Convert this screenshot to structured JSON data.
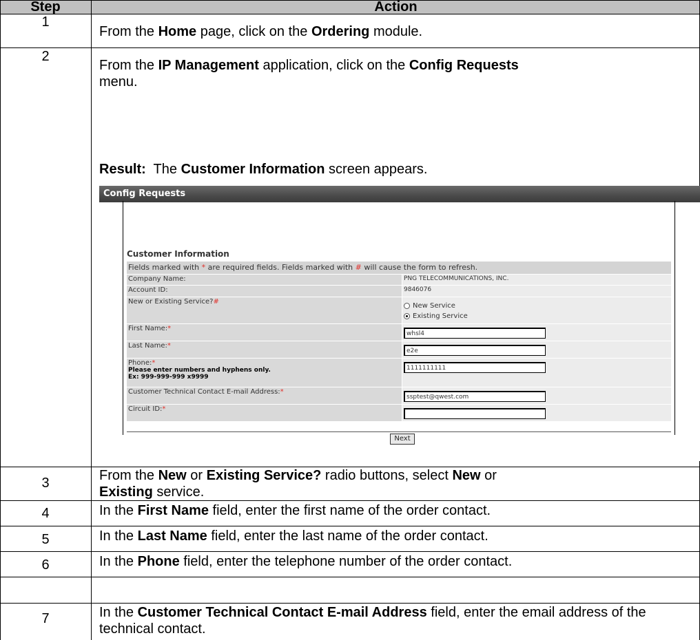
{
  "headers": {
    "step": "Step",
    "action": "Action"
  },
  "rows": [
    {
      "num": "1",
      "parts": [
        "From the ",
        "Home",
        " page, click on the ",
        "Ordering",
        " module."
      ]
    },
    {
      "num": "2",
      "parts": [
        "From the ",
        "IP Management",
        " application, click on the ",
        "Config Requests",
        " menu."
      ],
      "result_label": "Result:",
      "result_parts": [
        "  The ",
        "Customer Information",
        " screen appears."
      ]
    },
    {
      "num": "3",
      "parts": [
        "From the ",
        "New",
        " or ",
        "Existing Service?",
        " radio buttons, select ",
        "New",
        " or ",
        "Existing",
        " service."
      ]
    },
    {
      "num": "4",
      "parts": [
        "In the ",
        "First Name",
        " field, enter the first name of the order contact."
      ]
    },
    {
      "num": "5",
      "parts": [
        "In the ",
        "Last Name",
        " field, enter the last name of the order contact."
      ]
    },
    {
      "num": "6",
      "parts": [
        "In the ",
        "Phone",
        " field, enter the telephone number of the order contact."
      ]
    },
    {
      "num": "7",
      "parts": [
        "In the ",
        "Customer Technical Contact E-mail Address",
        " field, enter the email address of the technical contact."
      ]
    }
  ],
  "screenshot": {
    "title": "Config Requests",
    "section_title": "Customer Information",
    "notice": {
      "a": "Fields marked with ",
      "req": "*",
      "b": " are required fields. Fields marked with ",
      "ref": "#",
      "c": " will cause the form to refresh."
    },
    "company_label": "Company Name:",
    "company_value": "PNG TELECOMMUNICATIONS, INC.",
    "account_label": "Account ID:",
    "account_value": "9846076",
    "service_label": "New or Existing Service?",
    "service_mark": "#",
    "radio_new": "New Service",
    "radio_existing": "Existing Service",
    "first_label": "First Name:",
    "first_value": "whsl4",
    "last_label": "Last Name:",
    "last_value": "e2e",
    "phone_label": "Phone:",
    "phone_hint1": "Please enter numbers and hyphens only.",
    "phone_hint2": "Ex: 999-999-999 x9999",
    "phone_value": "1111111111",
    "email_label": "Customer Technical Contact E-mail Address:",
    "email_value": "ssptest@qwest.com",
    "circuit_label": "Circuit ID:",
    "circuit_value": "",
    "req_mark": "*",
    "next_label": "Next"
  }
}
